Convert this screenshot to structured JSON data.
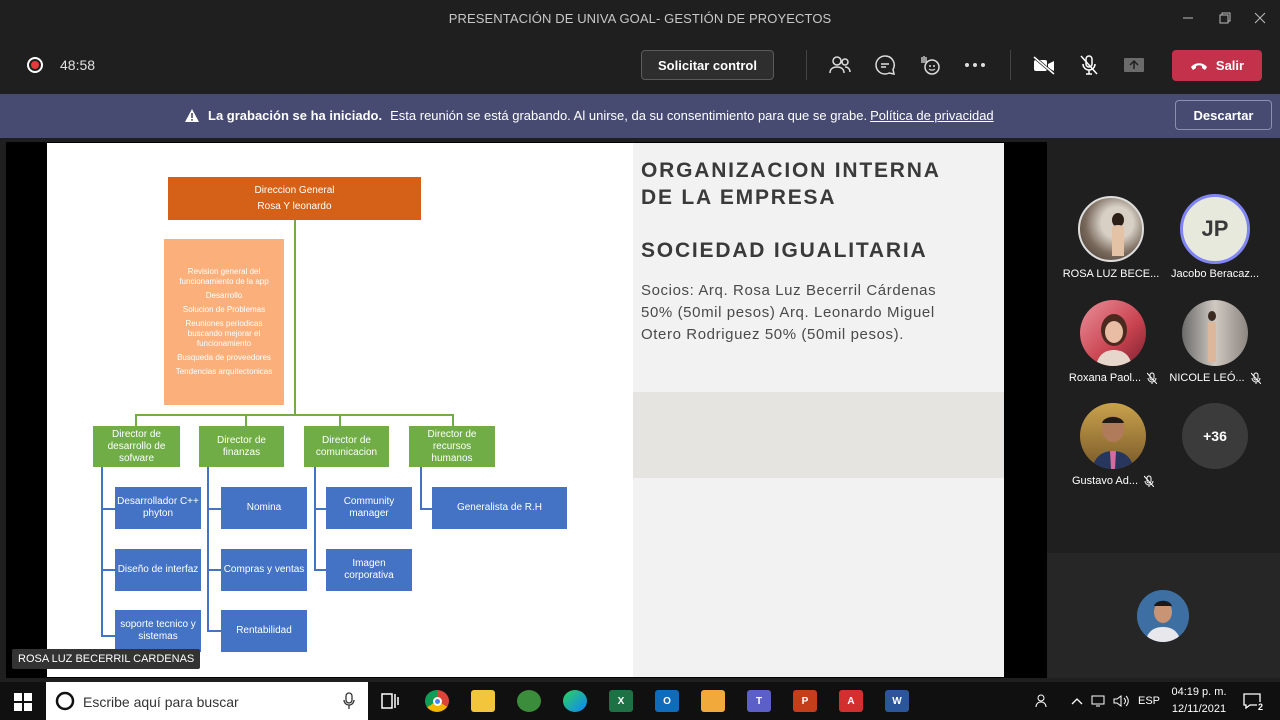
{
  "window": {
    "title": "PRESENTACIÓN DE UNIVA GOAL- GESTIÓN DE PROYECTOS"
  },
  "toolbar": {
    "timer": "48:58",
    "request_control": "Solicitar control",
    "leave": "Salir"
  },
  "banner": {
    "bold": "La grabación se ha iniciado.",
    "text": "Esta reunión se está grabando. Al unirse, da su consentimiento para que se grabe.",
    "link": "Política de privacidad",
    "dismiss": "Descartar"
  },
  "slide": {
    "title_line1": "ORGANIZACION INTERNA",
    "title_line2": "DE LA EMPRESA",
    "subtitle": "SOCIEDAD IGUALITARIA",
    "body": "Socios: Arq. Rosa Luz Becerril Cárdenas 50% (50mil pesos) Arq. Leonardo Miguel Otero Rodriguez 50% (50mil pesos).",
    "org": {
      "top_line1": "Direccion General",
      "top_line2": "Rosa Y leonardo",
      "tasks": [
        "Revision general del funcionamiento de la app",
        "Desarrollo",
        "Solucion de Problemas",
        "Reuniones periodicas buscando mejorar el funcionamiento",
        "Busqueda de proveedores",
        "Tendencias arquitectonicas"
      ],
      "directors": [
        "Director de desarrollo de sofware",
        "Director de finanzas",
        "Director de comunicacion",
        "Director de recursos humanos"
      ],
      "software": [
        "Desarrollador C++ phyton",
        "Diseño de interfaz",
        "soporte tecnico y sistemas"
      ],
      "finance": [
        "Nomina",
        "Compras y ventas",
        "Rentabilidad"
      ],
      "comms": [
        "Community manager",
        "Imagen corporativa"
      ],
      "hr": [
        "Generalista de R.H"
      ]
    }
  },
  "presenter": "ROSA LUZ BECERRIL CARDENAS",
  "participants": [
    {
      "name": "ROSA LUZ BECE...",
      "muted": false
    },
    {
      "name": "Jacobo Beracaz...",
      "initials": "JP",
      "muted": false
    },
    {
      "name": "Roxana Paol...",
      "muted": true
    },
    {
      "name": "NICOLE LEÓ...",
      "muted": true
    },
    {
      "name": "Gustavo Ad...",
      "muted": true
    }
  ],
  "more_count": "+36",
  "taskbar": {
    "search_placeholder": "Escribe aquí para buscar",
    "lang": "ESP",
    "time": "04:19 p. m.",
    "date": "12/11/2021",
    "notifications": "2"
  },
  "colors": {
    "leave": "#c4314b",
    "banner": "#474b72",
    "org_orange": "#d46117",
    "org_peach": "#fbb07b",
    "org_green": "#70ad47",
    "org_blue": "#4472c4"
  }
}
